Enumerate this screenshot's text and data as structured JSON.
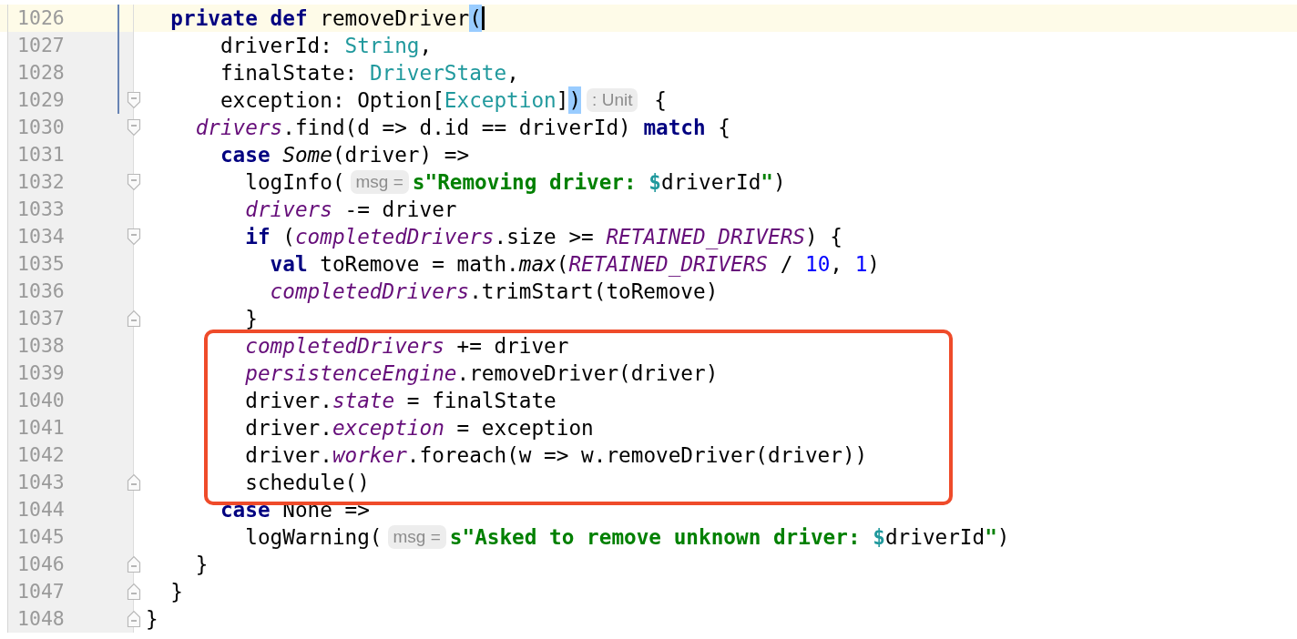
{
  "editor": {
    "blocks": [
      {
        "kind": "line",
        "number": "1026",
        "current": true,
        "modified": true,
        "caret": true,
        "fold_open": false,
        "fold_close": false,
        "tokens": [
          {
            "kind": "keyword",
            "text": "  private def"
          },
          {
            "kind": "plain",
            "text": " removeDriver"
          },
          {
            "kind": "brace",
            "text": "("
          }
        ]
      },
      {
        "kind": "line",
        "number": "1027",
        "current": false,
        "modified": true,
        "caret": false,
        "fold_open": false,
        "fold_close": false,
        "tokens": [
          {
            "kind": "plain",
            "text": "      driverId: "
          },
          {
            "kind": "type",
            "text": "String"
          },
          {
            "kind": "plain",
            "text": ","
          }
        ]
      },
      {
        "kind": "line",
        "number": "1028",
        "current": false,
        "modified": true,
        "caret": false,
        "fold_open": false,
        "fold_close": false,
        "tokens": [
          {
            "kind": "plain",
            "text": "      finalState: "
          },
          {
            "kind": "type",
            "text": "DriverState"
          },
          {
            "kind": "plain",
            "text": ","
          }
        ]
      },
      {
        "kind": "line",
        "number": "1029",
        "current": false,
        "modified": true,
        "caret": false,
        "fold_open": true,
        "fold_close": false,
        "tokens": [
          {
            "kind": "plain",
            "text": "      exception: Option["
          },
          {
            "kind": "type",
            "text": "Exception"
          },
          {
            "kind": "plain",
            "text": "]"
          },
          {
            "kind": "brace",
            "text": ")"
          },
          {
            "kind": "hint",
            "text": ": Unit"
          },
          {
            "kind": "plain",
            "text": " {"
          }
        ]
      },
      {
        "kind": "line",
        "number": "1030",
        "current": false,
        "modified": false,
        "caret": false,
        "fold_open": true,
        "fold_close": false,
        "tokens": [
          {
            "kind": "field",
            "text": "    drivers"
          },
          {
            "kind": "plain",
            "text": ".find(d => d.id == driverId) "
          },
          {
            "kind": "keyword",
            "text": "match"
          },
          {
            "kind": "plain",
            "text": " {"
          }
        ]
      },
      {
        "kind": "line",
        "number": "1031",
        "current": false,
        "modified": false,
        "caret": false,
        "fold_open": false,
        "fold_close": false,
        "tokens": [
          {
            "kind": "keyword",
            "text": "      case "
          },
          {
            "kind": "italic",
            "text": "Some"
          },
          {
            "kind": "plain",
            "text": "(driver) =>"
          }
        ]
      },
      {
        "kind": "line",
        "number": "1032",
        "current": false,
        "modified": false,
        "caret": false,
        "fold_open": true,
        "fold_close": false,
        "tokens": [
          {
            "kind": "plain",
            "text": "        logInfo("
          },
          {
            "kind": "hint",
            "text": "msg ="
          },
          {
            "kind": "string",
            "text": "s\"Removing driver: "
          },
          {
            "kind": "interp",
            "text": "$"
          },
          {
            "kind": "plain",
            "text": "driverId"
          },
          {
            "kind": "string",
            "text": "\""
          },
          {
            "kind": "plain",
            "text": ")"
          }
        ]
      },
      {
        "kind": "line",
        "number": "1033",
        "current": false,
        "modified": false,
        "caret": false,
        "fold_open": false,
        "fold_close": false,
        "tokens": [
          {
            "kind": "field",
            "text": "        drivers"
          },
          {
            "kind": "plain",
            "text": " -= driver"
          }
        ]
      },
      {
        "kind": "line",
        "number": "1034",
        "current": false,
        "modified": false,
        "caret": false,
        "fold_open": true,
        "fold_close": false,
        "tokens": [
          {
            "kind": "keyword",
            "text": "        if"
          },
          {
            "kind": "plain",
            "text": " ("
          },
          {
            "kind": "field",
            "text": "completedDrivers"
          },
          {
            "kind": "plain",
            "text": ".size >= "
          },
          {
            "kind": "field",
            "text": "RETAINED_DRIVERS"
          },
          {
            "kind": "plain",
            "text": ") {"
          }
        ]
      },
      {
        "kind": "line",
        "number": "1035",
        "current": false,
        "modified": false,
        "caret": false,
        "fold_open": false,
        "fold_close": false,
        "tokens": [
          {
            "kind": "keyword",
            "text": "          val"
          },
          {
            "kind": "plain",
            "text": " toRemove = math."
          },
          {
            "kind": "italic",
            "text": "max"
          },
          {
            "kind": "plain",
            "text": "("
          },
          {
            "kind": "field",
            "text": "RETAINED_DRIVERS"
          },
          {
            "kind": "plain",
            "text": " / "
          },
          {
            "kind": "number",
            "text": "10"
          },
          {
            "kind": "plain",
            "text": ", "
          },
          {
            "kind": "number",
            "text": "1"
          },
          {
            "kind": "plain",
            "text": ")"
          }
        ]
      },
      {
        "kind": "line",
        "number": "1036",
        "current": false,
        "modified": false,
        "caret": false,
        "fold_open": false,
        "fold_close": false,
        "tokens": [
          {
            "kind": "field",
            "text": "          completedDrivers"
          },
          {
            "kind": "plain",
            "text": ".trimStart(toRemove)"
          }
        ]
      },
      {
        "kind": "line",
        "number": "1037",
        "current": false,
        "modified": false,
        "caret": false,
        "fold_open": false,
        "fold_close": true,
        "tokens": [
          {
            "kind": "plain",
            "text": "        }"
          }
        ]
      },
      {
        "kind": "box",
        "lines": [
          {
            "kind": "line",
            "number": "1038",
            "current": false,
            "modified": false,
            "caret": false,
            "fold_open": false,
            "fold_close": false,
            "tokens": [
              {
                "kind": "field",
                "text": "        completedDrivers"
              },
              {
                "kind": "plain",
                "text": " += driver"
              }
            ]
          },
          {
            "kind": "line",
            "number": "1039",
            "current": false,
            "modified": false,
            "caret": false,
            "fold_open": false,
            "fold_close": false,
            "tokens": [
              {
                "kind": "field",
                "text": "        persistenceEngine"
              },
              {
                "kind": "plain",
                "text": ".removeDriver(driver)"
              }
            ]
          },
          {
            "kind": "line",
            "number": "1040",
            "current": false,
            "modified": false,
            "caret": false,
            "fold_open": false,
            "fold_close": false,
            "tokens": [
              {
                "kind": "plain",
                "text": "        driver."
              },
              {
                "kind": "field",
                "text": "state"
              },
              {
                "kind": "plain",
                "text": " = finalState"
              }
            ]
          },
          {
            "kind": "line",
            "number": "1041",
            "current": false,
            "modified": false,
            "caret": false,
            "fold_open": false,
            "fold_close": false,
            "tokens": [
              {
                "kind": "plain",
                "text": "        driver."
              },
              {
                "kind": "field",
                "text": "exception"
              },
              {
                "kind": "plain",
                "text": " = exception"
              }
            ]
          },
          {
            "kind": "line",
            "number": "1042",
            "current": false,
            "modified": false,
            "caret": false,
            "fold_open": false,
            "fold_close": false,
            "tokens": [
              {
                "kind": "plain",
                "text": "        driver."
              },
              {
                "kind": "field",
                "text": "worker"
              },
              {
                "kind": "plain",
                "text": ".foreach(w => w.removeDriver(driver))"
              }
            ]
          },
          {
            "kind": "line",
            "number": "1043",
            "current": false,
            "modified": false,
            "caret": false,
            "fold_open": false,
            "fold_close": true,
            "tokens": [
              {
                "kind": "plain",
                "text": "        schedule()"
              }
            ]
          }
        ]
      },
      {
        "kind": "line",
        "number": "1044",
        "current": false,
        "modified": false,
        "caret": false,
        "fold_open": false,
        "fold_close": false,
        "tokens": [
          {
            "kind": "keyword",
            "text": "      case"
          },
          {
            "kind": "plain",
            "text": " None =>"
          }
        ]
      },
      {
        "kind": "line",
        "number": "1045",
        "current": false,
        "modified": false,
        "caret": false,
        "fold_open": false,
        "fold_close": false,
        "tokens": [
          {
            "kind": "plain",
            "text": "        logWarning("
          },
          {
            "kind": "hint",
            "text": "msg ="
          },
          {
            "kind": "string",
            "text": "s\"Asked to remove unknown driver: "
          },
          {
            "kind": "interp",
            "text": "$"
          },
          {
            "kind": "plain",
            "text": "driverId"
          },
          {
            "kind": "string",
            "text": "\""
          },
          {
            "kind": "plain",
            "text": ")"
          }
        ]
      },
      {
        "kind": "line",
        "number": "1046",
        "current": false,
        "modified": false,
        "caret": false,
        "fold_open": false,
        "fold_close": true,
        "tokens": [
          {
            "kind": "plain",
            "text": "    }"
          }
        ]
      },
      {
        "kind": "line",
        "number": "1047",
        "current": false,
        "modified": false,
        "caret": false,
        "fold_open": false,
        "fold_close": true,
        "tokens": [
          {
            "kind": "plain",
            "text": "  }"
          }
        ]
      },
      {
        "kind": "line",
        "number": "1048",
        "current": false,
        "modified": false,
        "caret": false,
        "fold_open": false,
        "fold_close": true,
        "tokens": [
          {
            "kind": "plain",
            "text": "}"
          }
        ]
      }
    ]
  }
}
